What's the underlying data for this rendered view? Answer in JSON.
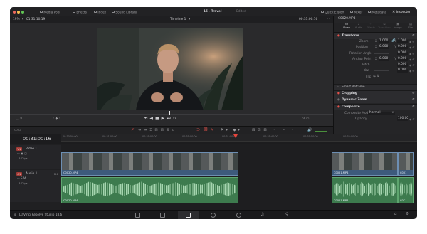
{
  "window": {
    "title": "15 - Travel",
    "edited_label": "Edited"
  },
  "topbar": {
    "media_pool": "Media Pool",
    "effects": "Effects",
    "index": "Index",
    "sound_library": "Sound Library",
    "quick_export": "Quick Export",
    "mixer": "Mixer",
    "metadata": "Metadata",
    "inspector": "Inspector"
  },
  "viewer": {
    "zoom": "19%",
    "timecode_left": "01:31:10:19",
    "timeline_name": "Timeline 1",
    "timecode_right": "00:31:00:16"
  },
  "inspector": {
    "clip_name": "C0020.MP4",
    "tabs": [
      "Video",
      "Audio",
      "Effects",
      "Transition",
      "Image",
      "File"
    ],
    "transform": {
      "title": "Transform",
      "zoom_label": "Zoom",
      "zoom_x": "1.000",
      "zoom_y": "1.000",
      "position_label": "Position",
      "position_x": "0.000",
      "position_y": "0.000",
      "rotation_label": "Rotation Angle",
      "rotation": "0.000",
      "anchor_label": "Anchor Point",
      "anchor_x": "0.000",
      "anchor_y": "0.000",
      "pitch_label": "Pitch",
      "pitch": "0.000",
      "yaw_label": "Yaw",
      "yaw": "0.000",
      "flip_label": "Flip"
    },
    "smart_reframe": "Smart Reframe",
    "cropping": "Cropping",
    "dynamic_zoom": "Dynamic Zoom",
    "composite": {
      "title": "Composite",
      "mode_label": "Composite Mode",
      "mode_value": "Normal",
      "opacity_label": "Opacity",
      "opacity_value": "100.00"
    }
  },
  "timeline": {
    "timecode": "00:31:00:16",
    "ruler_labels": [
      "00:30:50:00",
      "00:31:00:00",
      "00:31:00:00",
      "00:31:00:00",
      "00:31:00:00",
      "00:31:40:00",
      "00:31:50:00",
      "00:32:00:00"
    ],
    "tracks": {
      "v1_badge": "V1",
      "v1_name": "Video 1",
      "v1_count": "6 Clips",
      "a1_badge": "A1",
      "a1_name": "Audio 1",
      "a1_channels": "2.0",
      "a1_count": "6 Clips"
    },
    "clips": {
      "video_main": "C0020.MP4",
      "video_r1": "C0021.MP4",
      "video_r2": "C001",
      "audio_main": "C0020.MP4",
      "audio_r1": "C0021.MP4",
      "audio_r2": "C0C"
    }
  },
  "app": {
    "name": "DaVinci Resolve Studio 18.6"
  },
  "colors": {
    "accent_red": "#e6514a",
    "video_clip": "#3d5a7c",
    "audio_clip": "#3d7b4e",
    "playhead": "#e5453d"
  }
}
